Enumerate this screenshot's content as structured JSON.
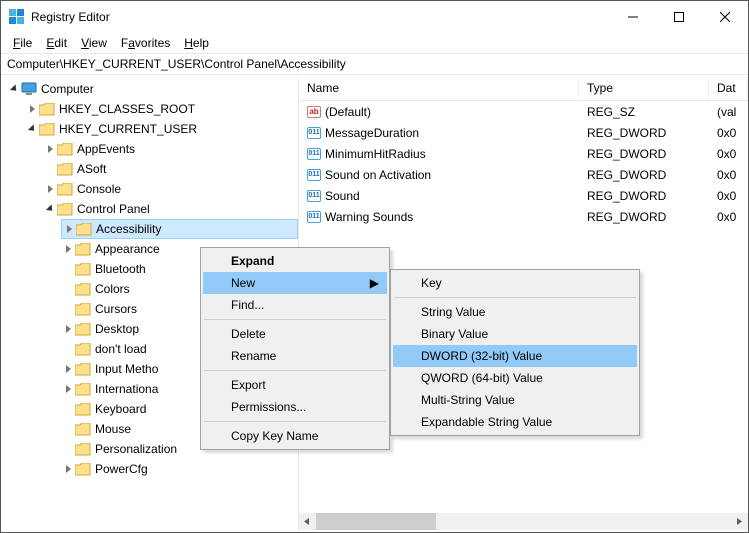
{
  "window": {
    "title": "Registry Editor"
  },
  "menu": {
    "file": "File",
    "edit": "Edit",
    "view": "View",
    "favorites": "Favorites",
    "help": "Help"
  },
  "addressbar": "Computer\\HKEY_CURRENT_USER\\Control Panel\\Accessibility",
  "tree": {
    "root": "Computer",
    "hkcr": "HKEY_CLASSES_ROOT",
    "hkcu": "HKEY_CURRENT_USER",
    "appEvents": "AppEvents",
    "asoft": "ASoft",
    "console": "Console",
    "controlPanel": "Control Panel",
    "accessibility": "Accessibility",
    "appearance": "Appearance",
    "bluetooth": "Bluetooth",
    "colors": "Colors",
    "cursors": "Cursors",
    "desktop": "Desktop",
    "dontload": "don't load",
    "inputmethod": "Input Metho",
    "international": "Internationa",
    "keyboard": "Keyboard",
    "mouse": "Mouse",
    "personalization": "Personalization",
    "powercfg": "PowerCfg"
  },
  "list": {
    "headers": {
      "name": "Name",
      "type": "Type",
      "data": "Dat"
    },
    "rows": [
      {
        "name": "(Default)",
        "type": "REG_SZ",
        "data": "(val",
        "icon": "abc"
      },
      {
        "name": "MessageDuration",
        "type": "REG_DWORD",
        "data": "0x0",
        "icon": "bin"
      },
      {
        "name": "MinimumHitRadius",
        "type": "REG_DWORD",
        "data": "0x0",
        "icon": "bin"
      },
      {
        "name": "Sound on Activation",
        "type": "REG_DWORD",
        "data": "0x0",
        "icon": "bin"
      },
      {
        "name": "Sound",
        "type": "REG_DWORD",
        "data": "0x0",
        "icon": "bin"
      },
      {
        "name": "Warning Sounds",
        "type": "REG_DWORD",
        "data": "0x0",
        "icon": "bin"
      }
    ]
  },
  "context1": {
    "expand": "Expand",
    "new": "New",
    "find": "Find...",
    "delete": "Delete",
    "rename": "Rename",
    "export": "Export",
    "permissions": "Permissions...",
    "copykey": "Copy Key Name"
  },
  "context2": {
    "key": "Key",
    "string": "String Value",
    "binary": "Binary Value",
    "dword32": "DWORD (32-bit) Value",
    "qword64": "QWORD (64-bit) Value",
    "multistr": "Multi-String Value",
    "expstr": "Expandable String Value"
  }
}
